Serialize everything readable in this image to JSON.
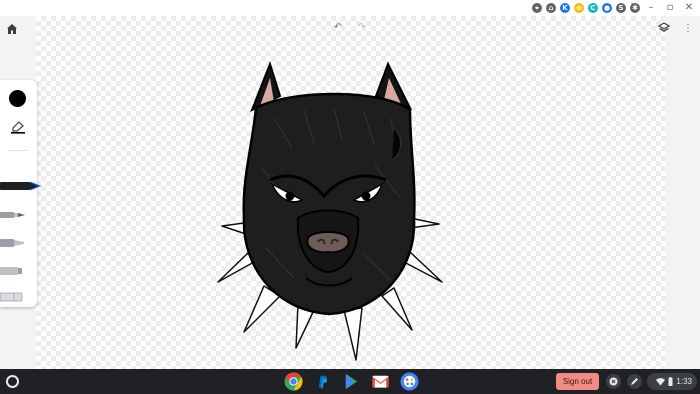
{
  "window": {
    "controls": {
      "minimize": "–",
      "maximize": "▫",
      "close": "✕"
    },
    "menu_icon": "more-vert-icon"
  },
  "extensions": [
    {
      "name": "location-icon",
      "color": "#5f6368",
      "glyph": "⌖"
    },
    {
      "name": "home-ext-icon",
      "color": "#5f6368",
      "glyph": "⌂"
    },
    {
      "name": "k-ext-icon",
      "color": "#1a73e8",
      "glyph": "K"
    },
    {
      "name": "ring-ext-icon",
      "color": "#fbbc04",
      "glyph": "o"
    },
    {
      "name": "c-ext-icon",
      "color": "#12b5cb",
      "glyph": "C"
    },
    {
      "name": "circle-ext-icon",
      "color": "#1a73e8",
      "glyph": "●"
    },
    {
      "name": "s-ext-icon",
      "color": "#5f6368",
      "glyph": "S"
    },
    {
      "name": "puzzle-icon",
      "color": "#5f6368",
      "glyph": "✱"
    }
  ],
  "canvas_app": {
    "home_icon": "home-icon",
    "undo_glyph": "↶",
    "redo_glyph": "↷",
    "layers_icon": "layers-icon",
    "more_glyph": "⋮",
    "selected_color": "#000000",
    "palette_tools": [
      "pen",
      "pencil",
      "marker",
      "highlighter",
      "eraser"
    ],
    "selected_tool": "pen",
    "drawing": "pit-bull-with-spiked-collar"
  },
  "shelf": {
    "apps": [
      {
        "name": "chrome-icon"
      },
      {
        "name": "paypal-icon"
      },
      {
        "name": "play-store-icon"
      },
      {
        "name": "gmail-icon"
      },
      {
        "name": "canvas-icon"
      }
    ],
    "sign_out_label": "Sign out",
    "time": "1:33"
  }
}
